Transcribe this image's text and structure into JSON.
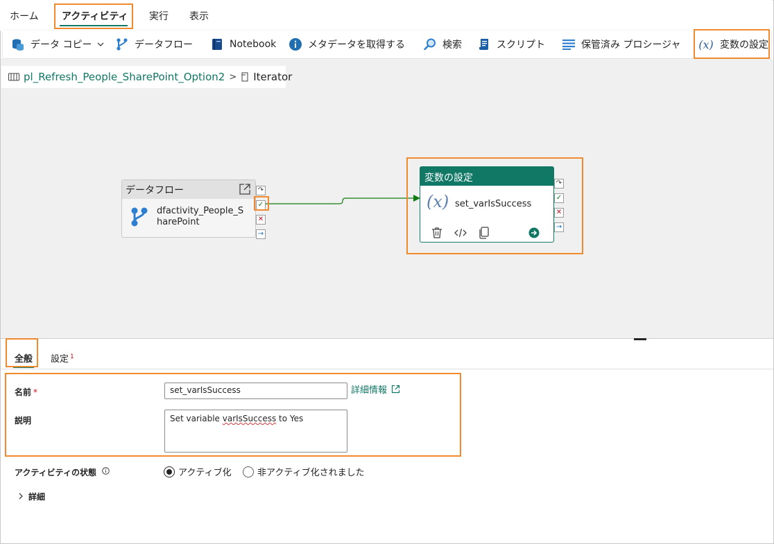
{
  "menu": {
    "tabs": [
      {
        "label": "ホーム"
      },
      {
        "label": "アクティビティ"
      },
      {
        "label": "実行"
      },
      {
        "label": "表示"
      }
    ]
  },
  "toolbar": {
    "items": [
      {
        "label": "データ コピー",
        "icon": "database-copy-icon"
      },
      {
        "label": "データフロー",
        "icon": "dataflow-icon"
      },
      {
        "label": "Notebook",
        "icon": "notebook-icon"
      },
      {
        "label": "メタデータを取得する",
        "icon": "info-icon"
      },
      {
        "label": "検索",
        "icon": "search-icon"
      },
      {
        "label": "スクリプト",
        "icon": "script-icon"
      },
      {
        "label": "保管済み プロシージャ",
        "icon": "stored-procedure-icon"
      },
      {
        "label": "変数の設定",
        "icon": "variable-fx-icon"
      }
    ]
  },
  "breadcrumb": {
    "pipeline": "pl_Refresh_People_SharePoint_Option2",
    "separator": ">",
    "current": "Iterator"
  },
  "canvas": {
    "dataflow_node": {
      "header": "データフロー",
      "name": "dfactivity_People_SharePoint"
    },
    "variable_node": {
      "header": "変数の設定",
      "fx": "(x)",
      "name": "set_varIsSuccess"
    }
  },
  "properties": {
    "tabs": [
      {
        "label": "全般"
      },
      {
        "label": "設定",
        "badge": "1"
      }
    ],
    "name_label": "名前",
    "required_mark": "*",
    "name_value": "set_varIsSuccess",
    "more_info_link": "詳細情報",
    "description_label": "説明",
    "description_before": "Set variable ",
    "description_misspelled": "varIsSuccess",
    "description_after": " to Yes",
    "state_label": "アクティビティの状態",
    "state_options": [
      {
        "label": "アクティブ化",
        "selected": true
      },
      {
        "label": "非アクティブ化されました",
        "selected": false
      }
    ],
    "advanced_label": "詳細"
  },
  "colors": {
    "accent": "#117865",
    "highlight": "#f08a2c",
    "success": "#107c10",
    "failure": "#c50f1f",
    "completion": "#0f6cbd"
  }
}
